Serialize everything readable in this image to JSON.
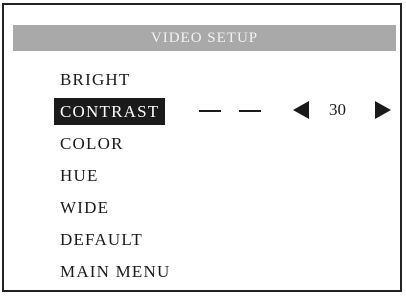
{
  "header": {
    "title": "VIDEO SETUP"
  },
  "menu": {
    "items": [
      {
        "label": "BRIGHT",
        "selected": false
      },
      {
        "label": "CONTRAST",
        "selected": true
      },
      {
        "label": "COLOR",
        "selected": false
      },
      {
        "label": "HUE",
        "selected": false
      },
      {
        "label": "WIDE",
        "selected": false
      },
      {
        "label": "DEFAULT",
        "selected": false
      },
      {
        "label": "MAIN MENU",
        "selected": false
      }
    ]
  },
  "adjust": {
    "value": "30",
    "left_icon": "arrow-left-icon",
    "right_icon": "arrow-right-icon"
  },
  "colors": {
    "header_bg": "#a9a9a9",
    "header_text": "#f2f2f2",
    "selected_bg": "#1b1b1b",
    "text": "#1a1a1a"
  }
}
